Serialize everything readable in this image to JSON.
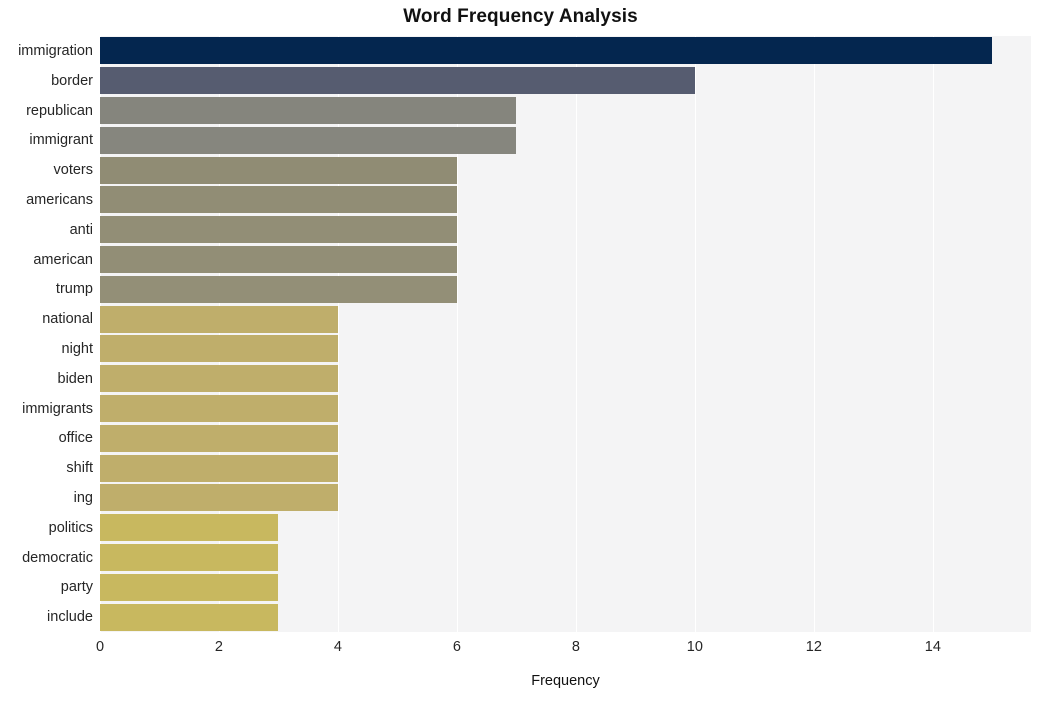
{
  "chart_data": {
    "type": "bar",
    "orientation": "horizontal",
    "title": "Word Frequency Analysis",
    "xlabel": "Frequency",
    "ylabel": "",
    "categories": [
      "immigration",
      "border",
      "republican",
      "immigrant",
      "voters",
      "americans",
      "anti",
      "american",
      "trump",
      "national",
      "night",
      "biden",
      "immigrants",
      "office",
      "shift",
      "ing",
      "politics",
      "democratic",
      "party",
      "include"
    ],
    "values": [
      15,
      10,
      7,
      7,
      6,
      6,
      6,
      6,
      6,
      4,
      4,
      4,
      4,
      4,
      4,
      4,
      3,
      3,
      3,
      3
    ],
    "bar_colors": [
      "#04264f",
      "#565c70",
      "#85857d",
      "#86867e",
      "#908c74",
      "#918d75",
      "#928e76",
      "#928e76",
      "#938f77",
      "#bfae6b",
      "#bfae6b",
      "#bfae6b",
      "#bfae6b",
      "#bfae6b",
      "#bfae6b",
      "#bfae6b",
      "#c8b85f",
      "#c8b85f",
      "#c8b85f",
      "#c8b85f"
    ],
    "xlim": [
      0,
      15.65
    ],
    "xticks": [
      0,
      2,
      4,
      6,
      8,
      10,
      12,
      14
    ],
    "xticklabels": [
      "0",
      "2",
      "4",
      "6",
      "8",
      "10",
      "12",
      "14"
    ],
    "grid": true,
    "grid_axis": "x",
    "grid_color": "#ffffff",
    "plot_background": "#f4f4f5",
    "figure_background": "#ffffff",
    "legend": null
  }
}
